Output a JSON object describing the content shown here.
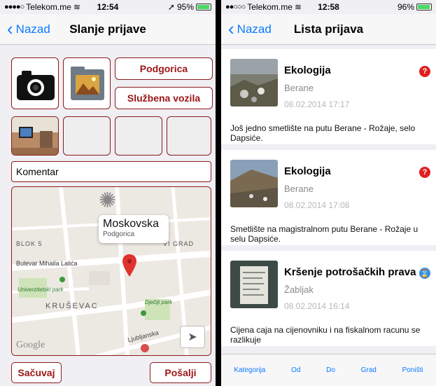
{
  "left": {
    "status": {
      "carrier": "Telekom.me",
      "time": "12:54",
      "battery": "95%",
      "battery_level": 0.95
    },
    "nav": {
      "back": "Nazad",
      "title": "Slanje prijave"
    },
    "city_button": "Podgorica",
    "category_button": "Službena vozila",
    "comment_placeholder": "Komentar",
    "map": {
      "callout_title": "Moskovska",
      "callout_sub": "Podgorica",
      "labels": [
        "BLOK 5",
        "VI GRAD",
        "Bulevar Mihaila Lalića",
        "Univerzitetski park",
        "KRUŠEVAC",
        "Dječiji park",
        "Ljubljanska",
        "Google"
      ]
    },
    "save_button": "Sačuvaj",
    "send_button": "Pošalji"
  },
  "right": {
    "status": {
      "carrier": "Telekom.me",
      "time": "12:58",
      "battery": "96%",
      "battery_level": 0.96
    },
    "nav": {
      "back": "Nazad",
      "title": "Lista prijava"
    },
    "items": [
      {
        "category": "Ekologija",
        "city": "Berane",
        "date": "08.02.2014 17:17",
        "description": "Još jedno smetlište na putu Berane - Rožaje, selo Dapsiće.",
        "status_icon": "question-icon",
        "status_glyph": "?",
        "status_color": "#e02020"
      },
      {
        "category": "Ekologija",
        "city": "Berane",
        "date": "08.02.2014 17:08",
        "description": "Smetlište na magistralnom putu Berane - Rožaje u selu Dapsiće.",
        "status_icon": "question-icon",
        "status_glyph": "?",
        "status_color": "#e02020"
      },
      {
        "category": "Kršenje potrošačkih prava",
        "city": "Žabljak",
        "date": "08.02.2014 16:14",
        "description": "Cijena caja na cijenovniku i na fiskalnom racunu se razlikuje",
        "status_icon": "hourglass-icon",
        "status_glyph": "⌛",
        "status_color": "#3b8ee0"
      }
    ],
    "tabs": [
      "Kategorija",
      "Od",
      "Do",
      "Grad",
      "Poništi"
    ]
  },
  "colors": {
    "accent": "#0a7aff",
    "brand": "#8b1a1a"
  }
}
